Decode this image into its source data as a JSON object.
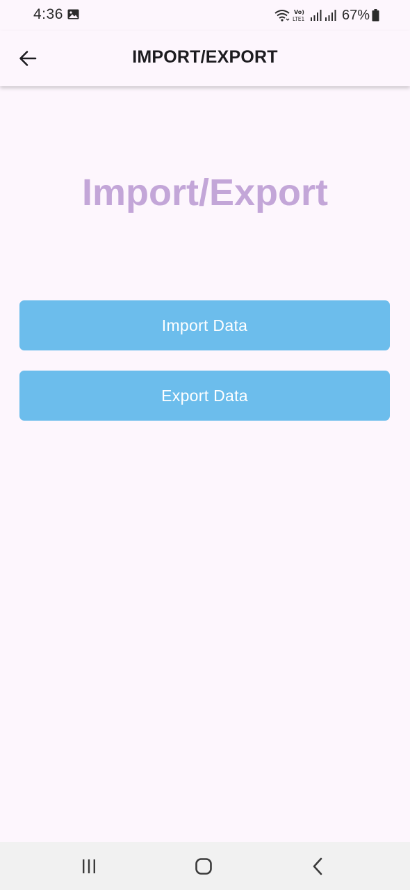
{
  "status_bar": {
    "time": "4:36",
    "battery_percent": "67%",
    "icons": [
      "gallery-icon",
      "wifi-icon",
      "volte-lte-icon",
      "signal-icon",
      "signal-icon",
      "battery-icon"
    ]
  },
  "app_bar": {
    "title": "IMPORT/EXPORT",
    "back_icon": "arrow-back-icon"
  },
  "main": {
    "heading": "Import/Export",
    "buttons": {
      "import_label": "Import Data",
      "export_label": "Export Data"
    }
  },
  "nav_bar": {
    "icons": [
      "recents-icon",
      "home-icon",
      "back-icon"
    ]
  },
  "colors": {
    "background": "#fdf6fd",
    "heading": "#c3a6d8",
    "button": "#6cbdec",
    "button_text": "#ffffff",
    "title": "#1c1b1f"
  }
}
